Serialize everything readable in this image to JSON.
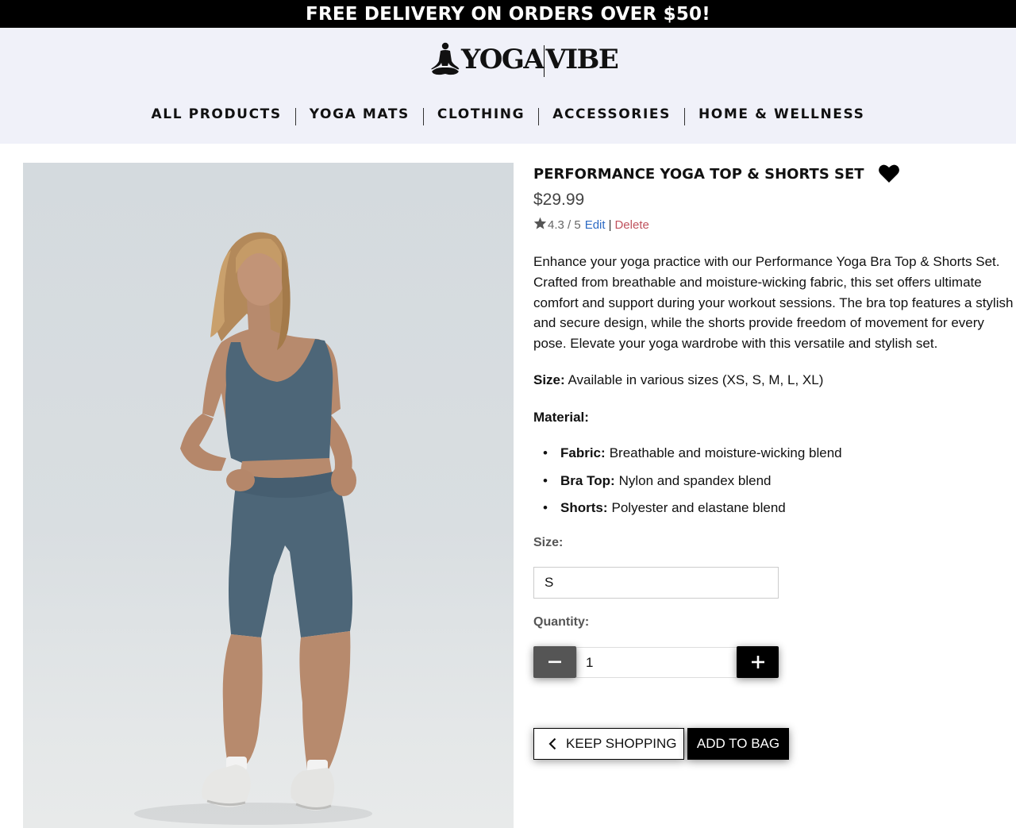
{
  "banner": {
    "text": "FREE DELIVERY ON ORDERS OVER $50!"
  },
  "brand": {
    "name_left": "YOGA",
    "name_right": "VIBE",
    "logo_icon": "meditation-icon"
  },
  "nav": {
    "items": [
      "ALL PRODUCTS",
      "YOGA MATS",
      "CLOTHING",
      "ACCESSORIES",
      "HOME & WELLNESS"
    ]
  },
  "product": {
    "title": "PERFORMANCE YOGA TOP & SHORTS SET",
    "price": "$29.99",
    "rating_text": "4.3 / 5",
    "edit_label": "Edit",
    "separator": "|",
    "delete_label": "Delete",
    "description": "Enhance your yoga practice with our Performance Yoga Bra Top & Shorts Set. Crafted from breathable and moisture-wicking fabric, this set offers ultimate comfort and support during your workout sessions. The bra top features a stylish and secure design, while the shorts provide freedom of movement for every pose. Elevate your yoga wardrobe with this versatile and stylish set.",
    "size_label": "Size:",
    "size_text": "Available in various sizes (XS, S, M, L, XL)",
    "material_label": "Material:",
    "materials": [
      {
        "name": "Fabric:",
        "value": "Breathable and moisture-wicking blend"
      },
      {
        "name": "Bra Top:",
        "value": "Nylon and spandex blend"
      },
      {
        "name": "Shorts:",
        "value": "Polyester and elastane blend"
      }
    ]
  },
  "form": {
    "size_field_label": "Size:",
    "size_value": "S",
    "quantity_label": "Quantity:",
    "quantity_value": "1",
    "keep_shopping_label": "KEEP SHOPPING",
    "add_to_bag_label": "ADD TO BAG"
  },
  "colors": {
    "banner_bg": "#000000",
    "header_bg": "#f0f1f9",
    "edit_link": "#2d6bc4",
    "delete_link": "#c0525d",
    "garment": "#4d6678"
  }
}
